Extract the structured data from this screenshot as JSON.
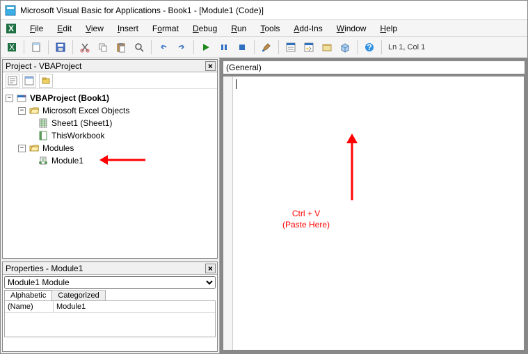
{
  "title": "Microsoft Visual Basic for Applications - Book1 - [Module1 (Code)]",
  "menu": {
    "file": "File",
    "edit": "Edit",
    "view": "View",
    "insert": "Insert",
    "format": "Format",
    "debug": "Debug",
    "run": "Run",
    "tools": "Tools",
    "addins": "Add-Ins",
    "window": "Window",
    "help": "Help"
  },
  "toolbar_status": "Ln 1, Col 1",
  "project_panel": {
    "title": "Project - VBAProject",
    "root": "VBAProject (Book1)",
    "excel_objects": "Microsoft Excel Objects",
    "sheet1": "Sheet1 (Sheet1)",
    "thiswb": "ThisWorkbook",
    "modules": "Modules",
    "module1": "Module1"
  },
  "properties_panel": {
    "title": "Properties - Module1",
    "combo": "Module1 Module",
    "tab1": "Alphabetic",
    "tab2": "Categorized",
    "name_label": "(Name)",
    "name_value": "Module1"
  },
  "code_dropdown": "(General)",
  "annotation": {
    "line1": "Ctrl + V",
    "line2": "(Paste Here)"
  }
}
